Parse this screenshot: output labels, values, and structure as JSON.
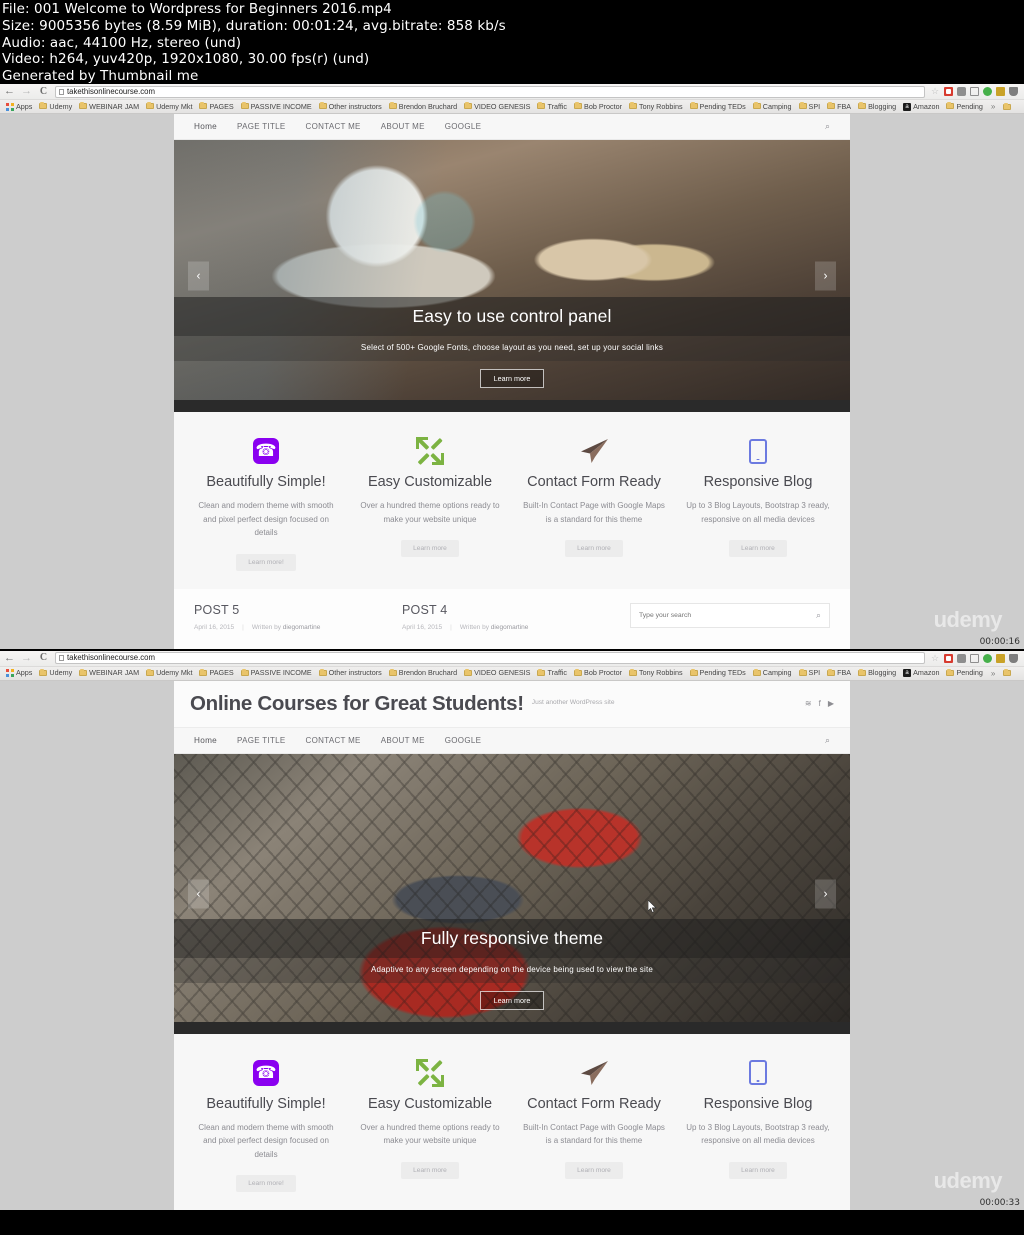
{
  "fileinfo": {
    "line1": "File: 001 Welcome to Wordpress for Beginners 2016.mp4",
    "line2": "Size: 9005356 bytes (8.59 MiB), duration: 00:01:24, avg.bitrate: 858 kb/s",
    "line3": "Audio: aac, 44100 Hz, stereo (und)",
    "line4": "Video: h264, yuv420p, 1920x1080, 30.00 fps(r) (und)",
    "line5": "Generated by Thumbnail me"
  },
  "browser": {
    "back_icon": "←",
    "forward_icon": "→",
    "reload_icon": "C",
    "url": "takethisonlinecourse.com",
    "star_icon": "☆",
    "bookmarks": [
      {
        "label": "Apps",
        "icon": "apps-grid"
      },
      {
        "label": "Udemy",
        "icon": "folder"
      },
      {
        "label": "WEBINAR JAM",
        "icon": "folder"
      },
      {
        "label": "Udemy Mkt",
        "icon": "folder"
      },
      {
        "label": "PAGES",
        "icon": "folder"
      },
      {
        "label": "PASSIVE INCOME",
        "icon": "folder"
      },
      {
        "label": "Other instructors",
        "icon": "folder"
      },
      {
        "label": "Brendon Bruchard",
        "icon": "folder"
      },
      {
        "label": "VIDEO GENESIS",
        "icon": "folder"
      },
      {
        "label": "Traffic",
        "icon": "folder"
      },
      {
        "label": "Bob Proctor",
        "icon": "folder"
      },
      {
        "label": "Tony Robbins",
        "icon": "folder"
      },
      {
        "label": "Pending TEDs",
        "icon": "folder"
      },
      {
        "label": "Camping",
        "icon": "folder"
      },
      {
        "label": "SPI",
        "icon": "folder"
      },
      {
        "label": "FBA",
        "icon": "folder"
      },
      {
        "label": "Blogging",
        "icon": "folder"
      },
      {
        "label": "Amazon",
        "icon": "amazon"
      },
      {
        "label": "Pending",
        "icon": "folder"
      }
    ],
    "overflow_icon": "»"
  },
  "site": {
    "title": "Online Courses for Great Students!",
    "tagline": "Just another WordPress site",
    "social": {
      "rss": "≋",
      "facebook": "f",
      "youtube": "▶"
    },
    "nav": [
      {
        "label": "Home"
      },
      {
        "label": "PAGE TITLE"
      },
      {
        "label": "CONTACT ME"
      },
      {
        "label": "ABOUT ME"
      },
      {
        "label": "GOOGLE"
      }
    ],
    "nav_search_icon": "⌕"
  },
  "shot1": {
    "slide": {
      "title": "Easy to use control panel",
      "subtitle": "Select of 500+ Google Fonts, choose layout as you need, set up your social links",
      "button": "Learn more",
      "prev_icon": "‹",
      "next_icon": "›"
    },
    "timestamp": "00:00:16",
    "watermark": "udemy"
  },
  "shot2": {
    "slide": {
      "title": "Fully responsive theme",
      "subtitle": "Adaptive to any screen depending on the device being used to view the site",
      "button": "Learn more",
      "prev_icon": "‹",
      "next_icon": "›"
    },
    "timestamp": "00:00:33",
    "watermark": "udemy"
  },
  "features": [
    {
      "icon": "phone-icon",
      "title": "Beautifully Simple!",
      "desc": "Clean and modern theme with smooth and pixel perfect design focused on details",
      "button": "Learn more!"
    },
    {
      "icon": "expand-arrows-icon",
      "title": "Easy Customizable",
      "desc": "Over a hundred theme options ready to make your website unique",
      "button": "Learn more"
    },
    {
      "icon": "paper-plane-icon",
      "title": "Contact Form Ready",
      "desc": "Built-In Contact Page with Google Maps is a standard for this theme",
      "button": "Learn more"
    },
    {
      "icon": "tablet-icon",
      "title": "Responsive Blog",
      "desc": "Up to 3 Blog Layouts, Bootstrap 3 ready, responsive on all media devices",
      "button": "Learn more"
    }
  ],
  "posts": [
    {
      "title": "POST 5",
      "date": "April 16, 2015",
      "written_by": "Written by",
      "author": "diegomartine"
    },
    {
      "title": "POST 4",
      "date": "April 16, 2015",
      "written_by": "Written by",
      "author": "diegomartine"
    }
  ],
  "search": {
    "placeholder": "Type your search",
    "icon": "⌕"
  },
  "colors": {
    "accent_purple": "#8a00f0",
    "accent_green": "#7cb342",
    "accent_blue": "#6c7ae0",
    "text_dark": "#4a4a50",
    "text_muted": "#8c8c92"
  }
}
